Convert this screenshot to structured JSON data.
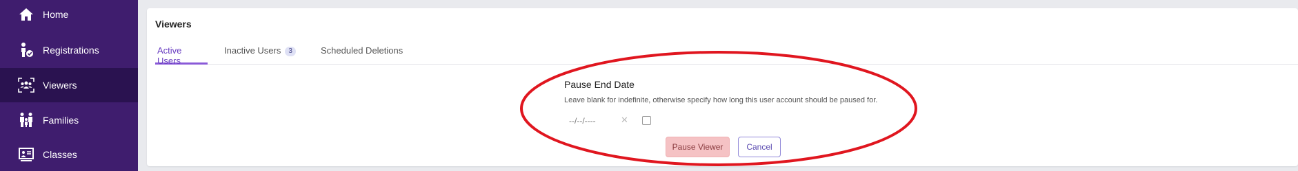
{
  "sidebar": {
    "items": [
      {
        "label": "Home",
        "icon": "home-icon"
      },
      {
        "label": "Registrations",
        "icon": "registrations-icon"
      },
      {
        "label": "Viewers",
        "icon": "viewers-icon",
        "active": true
      },
      {
        "label": "Families",
        "icon": "families-icon"
      },
      {
        "label": "Classes",
        "icon": "classes-icon"
      }
    ]
  },
  "card": {
    "title": "Viewers",
    "tabs": [
      {
        "label": "Active Users",
        "active": true
      },
      {
        "label": "Inactive Users",
        "badge": "3"
      },
      {
        "label": "Scheduled Deletions"
      }
    ]
  },
  "pause_form": {
    "title": "Pause End Date",
    "help": "Leave blank for indefinite, otherwise specify how long this user account should be paused for.",
    "date_placeholder": "--/--/----",
    "pause_button": "Pause Viewer",
    "cancel_button": "Cancel"
  },
  "colors": {
    "sidebar_bg": "#3f1d6e",
    "sidebar_active": "#2a1250",
    "accent": "#8a5ad8",
    "pause_button_bg": "#f5c2c4",
    "annotation": "#e0161f"
  }
}
